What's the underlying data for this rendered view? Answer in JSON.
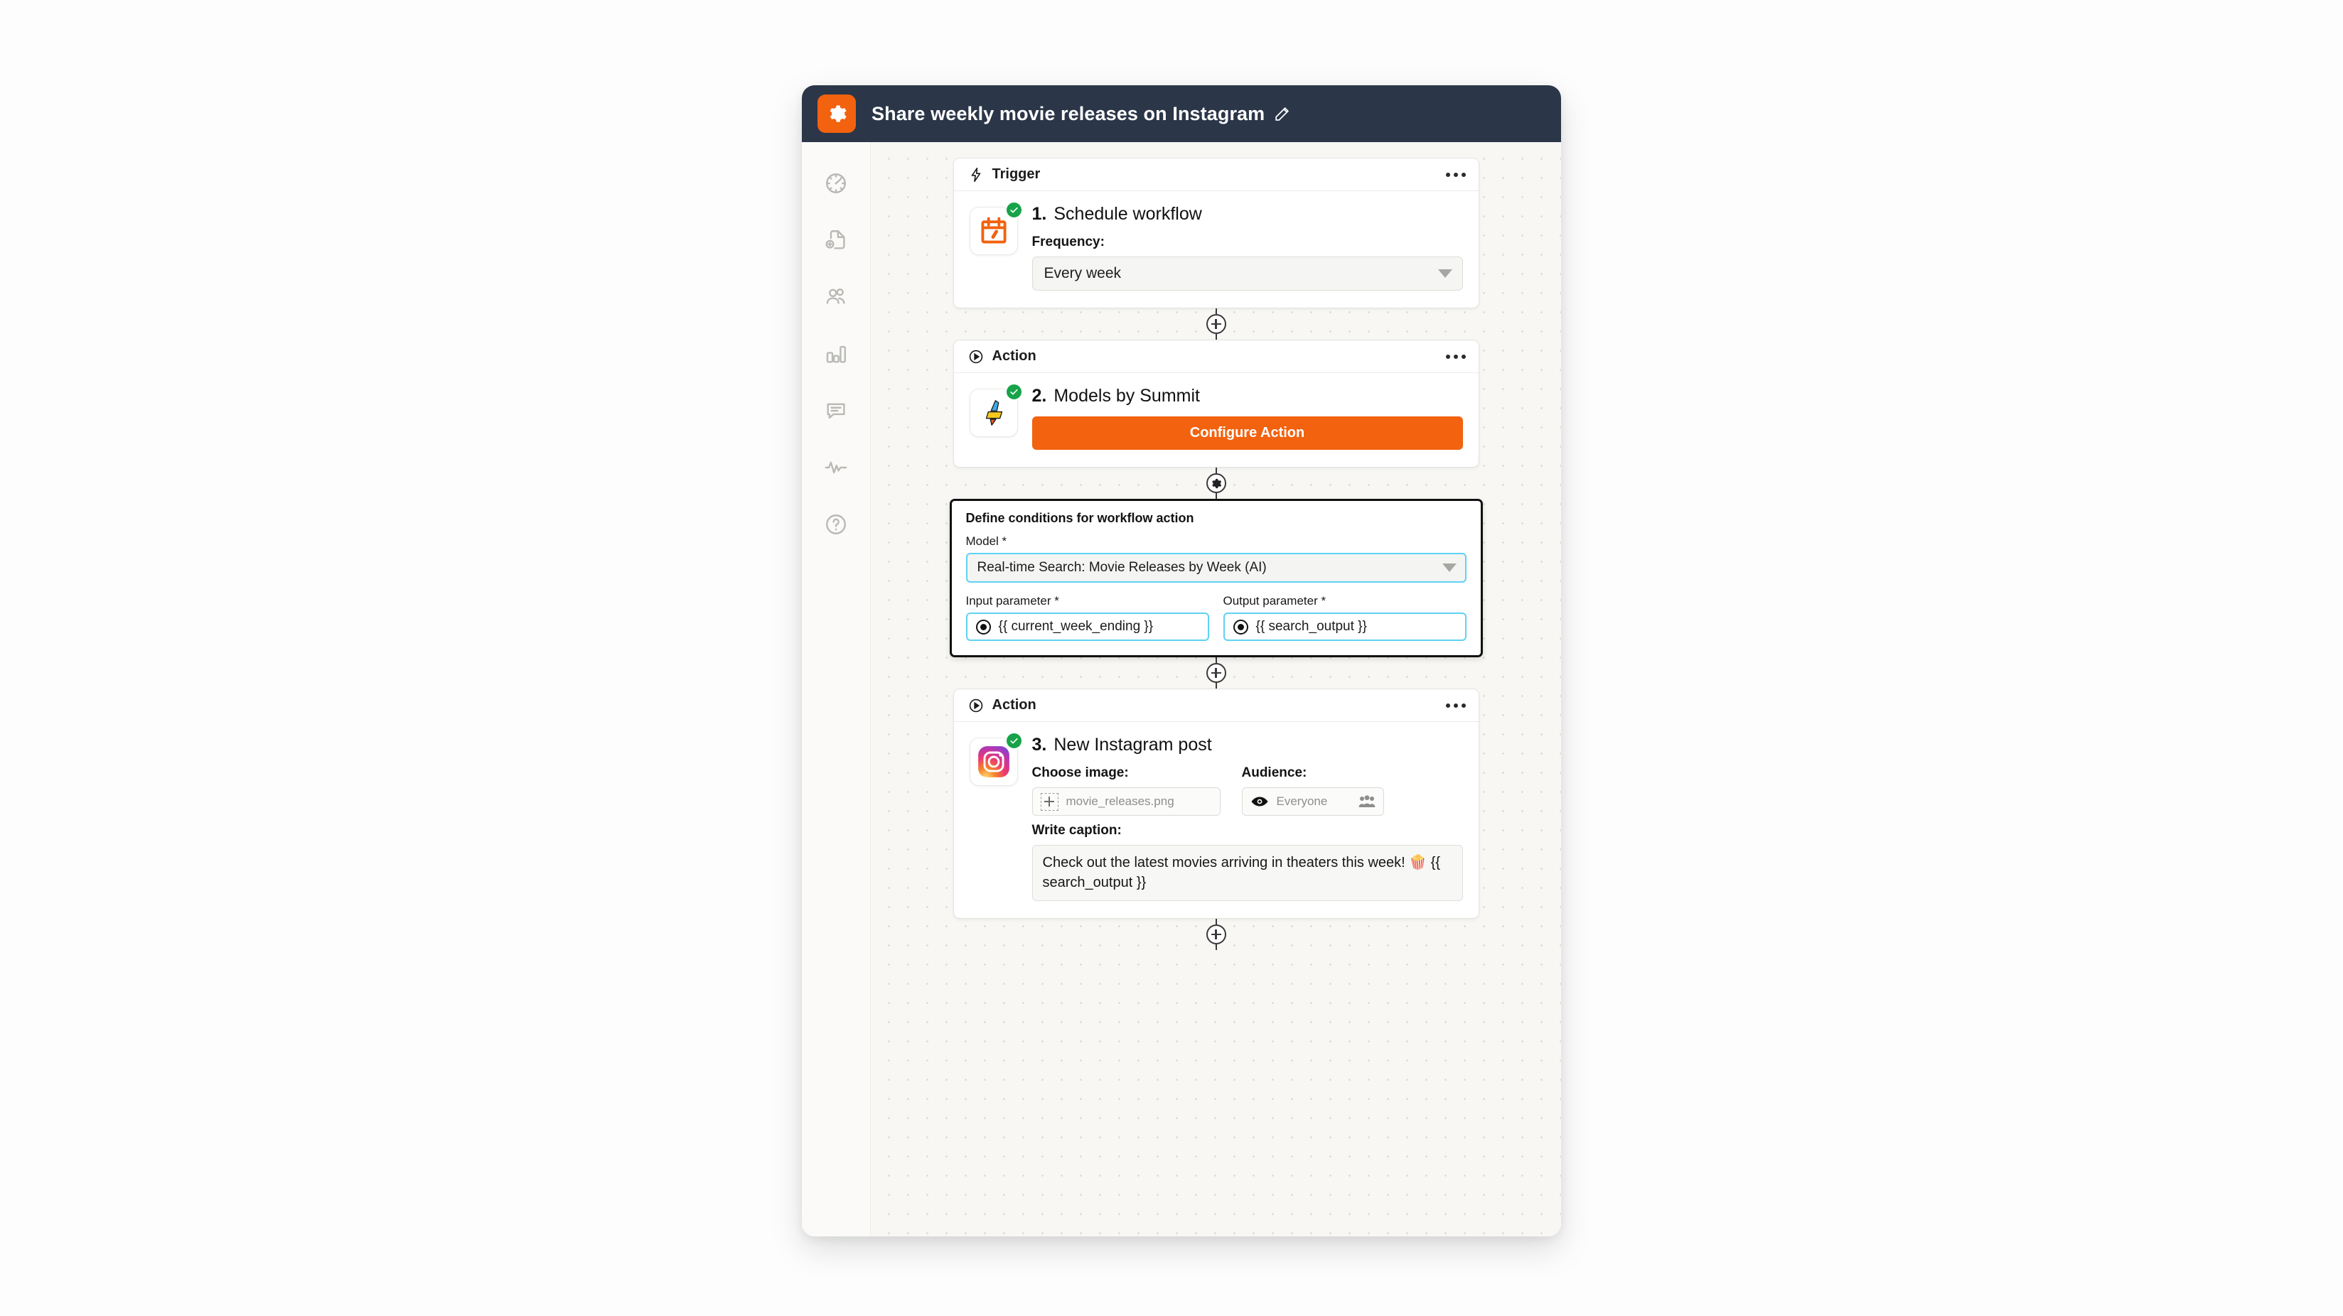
{
  "window": {
    "title": "Share weekly movie releases on Instagram",
    "app_icon": "gear-icon",
    "edit_icon": "pencil-icon"
  },
  "sidebar": {
    "items": [
      {
        "icon": "dashboard-gauge-icon",
        "name": "sidebar-item-dashboard"
      },
      {
        "icon": "document-add-icon",
        "name": "sidebar-item-new-document"
      },
      {
        "icon": "people-icon",
        "name": "sidebar-item-contacts"
      },
      {
        "icon": "bar-chart-icon",
        "name": "sidebar-item-reports"
      },
      {
        "icon": "chat-bubble-icon",
        "name": "sidebar-item-messages"
      },
      {
        "icon": "activity-pulse-icon",
        "name": "sidebar-item-activity"
      },
      {
        "icon": "help-circle-icon",
        "name": "sidebar-item-help"
      }
    ]
  },
  "flow": {
    "trigger_card": {
      "header_label": "Trigger",
      "header_icon": "lightning-bolt-icon",
      "menu_icon": "ellipsis-icon",
      "app_icon": "calendar-schedule-icon",
      "status_icon": "check-circle-icon",
      "step_number": "1.",
      "step_title": "Schedule workflow",
      "frequency_label": "Frequency:",
      "frequency_value": "Every week"
    },
    "connector_1": {
      "icon": "plus-circle-icon"
    },
    "action_card_2": {
      "header_label": "Action",
      "header_icon": "play-circle-icon",
      "menu_icon": "ellipsis-icon",
      "app_icon": "summit-bolt-icon",
      "status_icon": "check-circle-icon",
      "step_number": "2.",
      "step_title": "Models by Summit",
      "configure_button": "Configure Action"
    },
    "connector_2": {
      "icon": "gear-circle-icon"
    },
    "conditions_panel": {
      "title": "Define conditions for workflow action",
      "model_label": "Model *",
      "model_value": "Real-time Search: Movie Releases by Week (AI)",
      "input_label": "Input parameter *",
      "input_value": "{{ current_week_ending }}",
      "output_label": "Output parameter *",
      "output_value": "{{ search_output }}",
      "focus_color": "#5ed2f5"
    },
    "connector_3": {
      "icon": "plus-circle-icon"
    },
    "action_card_3": {
      "header_label": "Action",
      "header_icon": "play-circle-icon",
      "menu_icon": "ellipsis-icon",
      "app_icon": "instagram-icon",
      "status_icon": "check-circle-icon",
      "step_number": "3.",
      "step_title": "New Instagram post",
      "image_label": "Choose image:",
      "image_value": "movie_releases.png",
      "audience_label": "Audience:",
      "audience_value": "Everyone",
      "audience_icon": "eye-icon",
      "audience_group_icon": "people-group-icon",
      "caption_label": "Write caption:",
      "caption_value": "Check out the latest movies arriving in theaters this week! 🍿 {{ search_output }}"
    },
    "connector_4": {
      "icon": "plus-circle-icon"
    }
  },
  "colors": {
    "brand_orange": "#f2620f",
    "header_navy": "#2b3648",
    "success_green": "#17a349",
    "focus_cyan": "#5ed2f5"
  }
}
